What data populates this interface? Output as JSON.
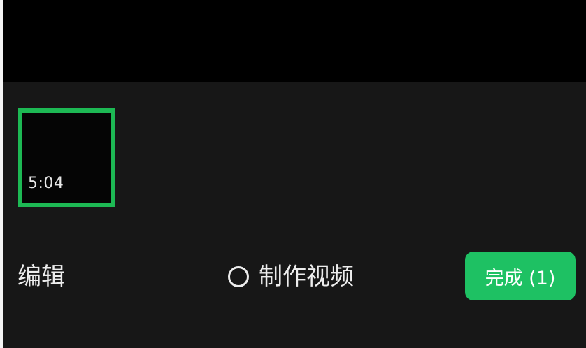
{
  "media_strip": {
    "selected_clip": {
      "duration": "5:04"
    }
  },
  "bottom_bar": {
    "edit_label": "编辑",
    "make_video_label": "制作视频",
    "done_label": "完成 (1)"
  },
  "colors": {
    "accent": "#1ec163",
    "selection_border": "#1db954",
    "panel_background": "#171717",
    "preview_background": "#000000"
  },
  "icons": {
    "make_video_toggle": "radio-circle-icon"
  }
}
